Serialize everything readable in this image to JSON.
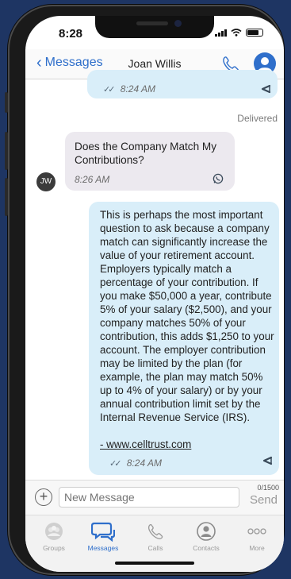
{
  "status": {
    "time": "8:28"
  },
  "nav": {
    "back_label": "Messages",
    "contact_name": "Joan Willis"
  },
  "messages": [
    {
      "direction": "out",
      "time": "8:24 AM",
      "status": "Delivered"
    },
    {
      "direction": "in",
      "avatar": "JW",
      "text": "Does the Company Match My Contributions?",
      "time": "8:26 AM"
    },
    {
      "direction": "out",
      "text": "This is perhaps the most important question to ask because a company match can significantly increase the value of your retirement account. Employers typically match a percentage of your contribution. If you make $50,000 a year, contribute 5% of your salary ($2,500), and your company matches 50% of your contribution, this adds $1,250 to your account. The employer contribution may be limited by the plan (for example, the plan may match 50% up to 4% of your salary) or by your annual contribution limit set by the Internal Revenue Service (IRS).",
      "link": "- www.celltrust.com",
      "time": "8:24 AM"
    }
  ],
  "composer": {
    "placeholder": "New Message",
    "counter": "0/1500",
    "send_label": "Send"
  },
  "tabs": [
    {
      "label": "Groups",
      "icon": "groups-icon",
      "active": false
    },
    {
      "label": "Messages",
      "icon": "messages-icon",
      "active": true
    },
    {
      "label": "Calls",
      "icon": "phone-icon",
      "active": false
    },
    {
      "label": "Contacts",
      "icon": "contacts-icon",
      "active": false
    },
    {
      "label": "More",
      "icon": "more-icon",
      "active": false
    }
  ],
  "colors": {
    "accent": "#2f6fcb",
    "outgoing_bubble": "#d9eef9",
    "incoming_bubble": "#ece9ef",
    "background": "#1e3563"
  }
}
